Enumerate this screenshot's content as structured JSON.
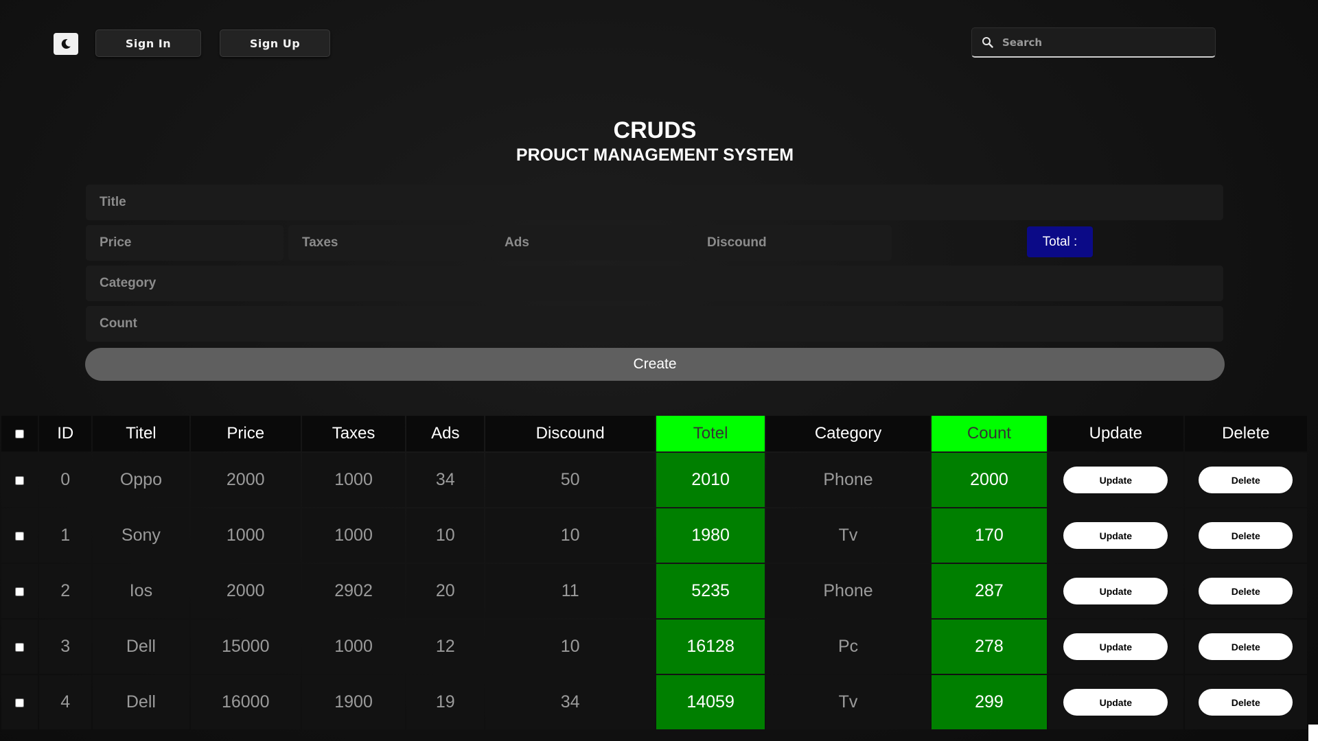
{
  "header": {
    "theme_toggle_icon": "moon-icon",
    "sign_in": "Sign In",
    "sign_up": "Sign Up",
    "search_placeholder": "Search",
    "search_icon": "search-icon"
  },
  "title": "CRUDS",
  "subtitle": "PROUCT MANAGEMENT SYSTEM",
  "form": {
    "title_placeholder": "Title",
    "price_placeholder": "Price",
    "taxes_placeholder": "Taxes",
    "ads_placeholder": "Ads",
    "discount_placeholder": "Discound",
    "total_label": "Total :",
    "category_placeholder": "Category",
    "count_placeholder": "Count",
    "create_label": "Create"
  },
  "colors": {
    "total_bg": "#0b0a87",
    "green_header": "#00ff00",
    "green_cell": "#007f00"
  },
  "table": {
    "headers": [
      "ID",
      "Titel",
      "Price",
      "Taxes",
      "Ads",
      "Discound",
      "Totel",
      "Category",
      "Count",
      "Update",
      "Delete"
    ],
    "update_label": "Update",
    "delete_label": "Delete",
    "rows": [
      {
        "id": "0",
        "title": "Oppo",
        "price": "2000",
        "taxes": "1000",
        "ads": "34",
        "discount": "50",
        "total": "2010",
        "category": "Phone",
        "count": "2000"
      },
      {
        "id": "1",
        "title": "Sony",
        "price": "1000",
        "taxes": "1000",
        "ads": "10",
        "discount": "10",
        "total": "1980",
        "category": "Tv",
        "count": "170"
      },
      {
        "id": "2",
        "title": "Ios",
        "price": "2000",
        "taxes": "2902",
        "ads": "20",
        "discount": "11",
        "total": "5235",
        "category": "Phone",
        "count": "287"
      },
      {
        "id": "3",
        "title": "Dell",
        "price": "15000",
        "taxes": "1000",
        "ads": "12",
        "discount": "10",
        "total": "16128",
        "category": "Pc",
        "count": "278"
      },
      {
        "id": "4",
        "title": "Dell",
        "price": "16000",
        "taxes": "1900",
        "ads": "19",
        "discount": "34",
        "total": "14059",
        "category": "Tv",
        "count": "299"
      }
    ]
  }
}
